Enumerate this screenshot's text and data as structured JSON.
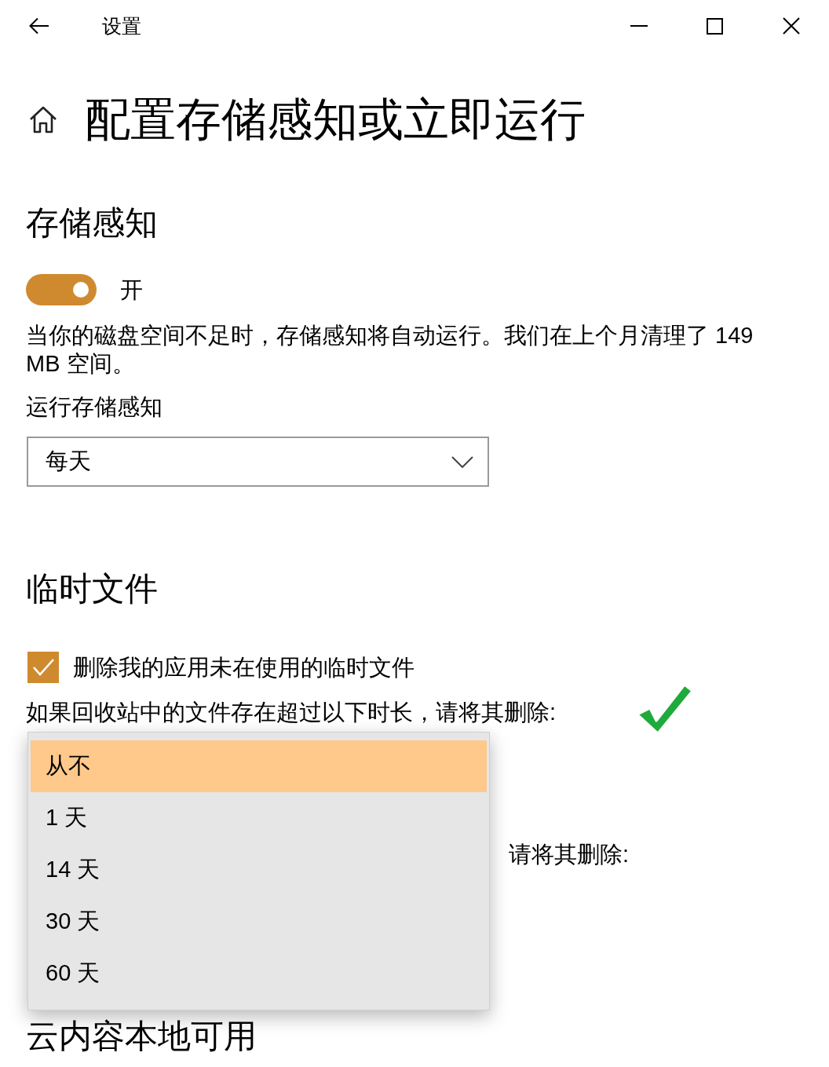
{
  "window": {
    "title": "设置"
  },
  "page": {
    "title": "配置存储感知或立即运行"
  },
  "storage_sense": {
    "heading": "存储感知",
    "toggle": {
      "on": true,
      "label": "开"
    },
    "description": "当你的磁盘空间不足时，存储感知将自动运行。我们在上个月清理了 149 MB 空间。",
    "run_label": "运行存储感知",
    "run_dropdown": {
      "value": "每天"
    }
  },
  "temp_files": {
    "heading": "临时文件",
    "delete_app_temp": {
      "checked": true,
      "label": "删除我的应用未在使用的临时文件"
    },
    "recycle_bin_label": "如果回收站中的文件存在超过以下时长，请将其删除:",
    "recycle_bin_dropdown": {
      "expanded": true,
      "options": [
        {
          "label": "从不",
          "selected": true
        },
        {
          "label": "1 天",
          "selected": false
        },
        {
          "label": "14 天",
          "selected": false
        },
        {
          "label": "30 天",
          "selected": false
        },
        {
          "label": "60 天",
          "selected": false
        }
      ]
    },
    "next_label_fragment": "请将其删除:"
  },
  "cloud_content": {
    "heading": "云内容本地可用"
  }
}
